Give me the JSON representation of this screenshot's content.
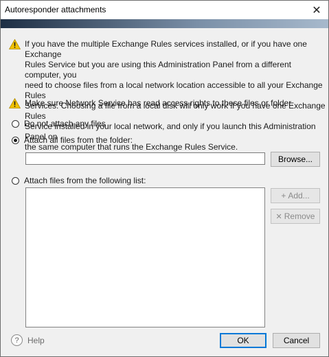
{
  "window": {
    "title": "Autoresponder attachments",
    "close_glyph": "✕"
  },
  "warnings": {
    "icon": "warning-triangle-icon",
    "icon_color": "#f2c200",
    "first_lines": [
      "If you have the multiple Exchange Rules services installed, or if you have one Exchange",
      "Rules Service but you are using this Administration Panel from a different computer, you",
      "need to choose files from a local network location accessible to all your Exchange Rules",
      "Services. Choosing a file from a local disk will only work if you have one Exchange Rules",
      "Service installed in your local network, and only if you launch this Administration Panel on",
      "the same computer that runs the Exchange Rules Service."
    ],
    "second": "Make sure Network Service has read access rights to these files or folder."
  },
  "options": {
    "no_files": {
      "label": "Do not attach any files",
      "checked": false
    },
    "folder": {
      "label": "Attach all files from the folder:",
      "checked": true,
      "value": ""
    },
    "list": {
      "label": "Attach files from the following list:",
      "checked": false
    }
  },
  "buttons": {
    "browse": "Browse...",
    "add": "Add...",
    "add_icon": "+",
    "remove": "Remove",
    "remove_icon": "✕",
    "ok": "OK",
    "cancel": "Cancel"
  },
  "help": {
    "label": "Help",
    "icon_glyph": "?"
  },
  "colors": {
    "accent": "#0078d7",
    "banner_dark": "#1e2f44",
    "banner_light": "#a7b9cc"
  }
}
